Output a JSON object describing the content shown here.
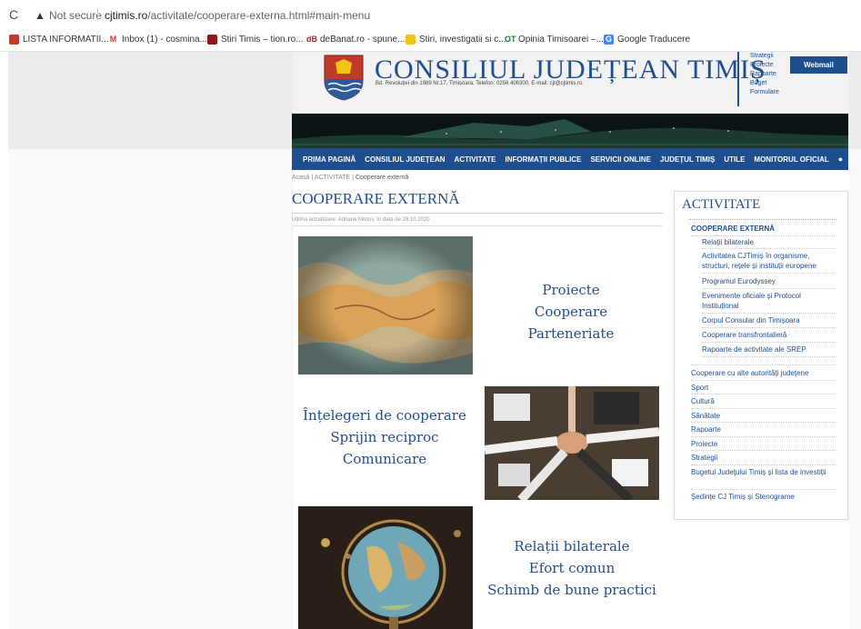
{
  "browser": {
    "reload_icon": "reload-icon",
    "security_text": "Not secure",
    "url_host": "cjtimis.ro",
    "url_path": "/activitate/cooperare-externa.html#main-menu",
    "bookmarks": [
      {
        "label": "LISTA INFORMATII...",
        "icon": "flag-icon",
        "color": "#c0392b"
      },
      {
        "label": "Inbox (1) - cosmina...",
        "icon": "gmail-icon",
        "color": "#d93025"
      },
      {
        "label": "Stiri Timis – tion.ro...",
        "icon": "news-icon",
        "color": "#8b1a1a"
      },
      {
        "label": "deBanat.ro - spune...",
        "icon": "debanat-icon",
        "color": "#b22222"
      },
      {
        "label": "Stiri, investigatii si c...",
        "icon": "news-icon",
        "color": "#f1c40f"
      },
      {
        "label": "Opinia Timisoarei –...",
        "icon": "opinia-icon",
        "color": "#1e7b3a"
      },
      {
        "label": "Google Traducere",
        "icon": "translate-icon",
        "color": "#4285f4"
      }
    ]
  },
  "site": {
    "title": "CONSILIUL JUDEȚEAN TIMIȘ",
    "address": "Bd. Revoluției din 1989 Nr.17, Timișoara, Telefon: 0256 406300, E-mail: cjt@cjtimis.ro",
    "quick_links": [
      "Strategii",
      "Proiecte",
      "Rapoarte",
      "Buget",
      "Formulare"
    ],
    "webmail": "Webmail",
    "nav": [
      "PRIMA PAGINĂ",
      "CONSILIUL JUDEȚEAN",
      "ACTIVITATE",
      "INFORMAȚII PUBLICE",
      "SERVICII ONLINE",
      "JUDEȚUL TIMIȘ",
      "UTILE",
      "MONITORUL OFICIAL"
    ],
    "accent": "#1f4e8f"
  },
  "breadcrumb": {
    "home": "Acasă",
    "sep": "|",
    "section": "ACTIVITATE",
    "current": "Cooperare externă"
  },
  "content": {
    "title": "COOPERARE EXTERNĂ",
    "updated": "Ultima actualizare: Adriana Mistov, în data de 28.10.2020",
    "block1": [
      "Proiecte",
      "Cooperare",
      "Parteneriate"
    ],
    "block2": [
      "Înțelegeri de cooperare",
      "Sprijin reciproc",
      "Comunicare"
    ],
    "block3": [
      "Relații bilaterale",
      "Efort comun",
      "Schimb de bune practici"
    ]
  },
  "sidebar": {
    "title": "ACTIVITATE",
    "section": "COOPERARE EXTERNĂ",
    "sub": [
      "Relații bilaterale",
      "Activitatea CJTimiș în organisme, structuri, rețele și instituții europene",
      "Programul Eurodyssey",
      "Evenimente oficiale și Protocol Instituțional",
      "Corpul Consular din Timișoara",
      "Cooperare transfrontalieră",
      "Rapoarte de activitate ale SREP"
    ],
    "items": [
      "Cooperare cu alte autorități județene",
      "Sport",
      "Cultură",
      "Sănătate",
      "Rapoarte",
      "Proiecte",
      "Strategii",
      "Bugetul Județului Timiș și lista de investiții",
      "Ședințe CJ Timiș și Stenograme"
    ]
  }
}
